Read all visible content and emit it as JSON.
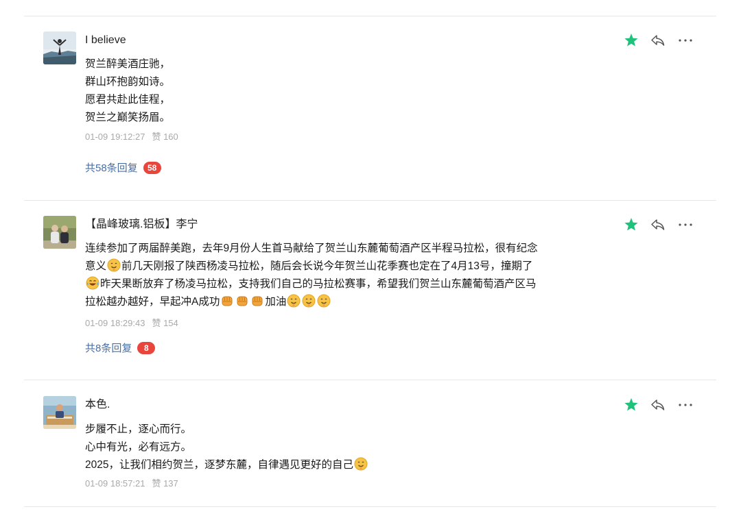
{
  "colors": {
    "star": "#1ec27a",
    "reply_link": "#4a6ea5",
    "badge": "#e8453c",
    "meta": "#a9a9a9"
  },
  "comments": [
    {
      "author": "I believe",
      "avatar": "avatar",
      "lines": [
        {
          "text": "贺兰醉美酒庄驰，"
        },
        {
          "text": "群山环抱韵如诗。"
        },
        {
          "text": "愿君共赴此佳程，"
        },
        {
          "text": "贺兰之巅笑扬眉。"
        }
      ],
      "time": "01-09 19:12:27",
      "likes": "赞 160",
      "replies_label": "共58条回复",
      "replies_count": "58",
      "icons": [
        "star-icon",
        "reply-arrow-icon",
        "more-dots-icon"
      ]
    },
    {
      "author": "【晶峰玻璃.铝板】李宁",
      "avatar": "avatar",
      "lines": [
        {
          "text": "连续参加了两届醉美跑，去年9月份人生首马献给了贺兰山东麓葡萄酒产区半程马拉松，很有纪念"
        },
        {
          "a": "意义",
          "b": "前几天刚报了陕西杨凌马拉松，随后会长说今年贺兰山花季赛也定在了4月13号，撞期了"
        },
        {
          "b": "昨天果断放弃了杨凌马拉松，支持我们自己的马拉松赛事，希望我们贺兰山东麓葡萄酒产区马"
        },
        {
          "a": "拉松越办越好，早起冲A成功",
          "c": "加油"
        }
      ],
      "time": "01-09 18:29:43",
      "likes": "赞 154",
      "replies_label": "共8条回复",
      "replies_count": "8",
      "icons": [
        "star-icon",
        "reply-arrow-icon",
        "more-dots-icon"
      ]
    },
    {
      "author": "本色.",
      "avatar": "avatar",
      "lines": [
        {
          "text": "步履不止，逐心而行。"
        },
        {
          "text": "心中有光，必有远方。"
        },
        {
          "a": "2025，让我们相约贺兰，逐梦东麓，自律遇见更好的自己"
        }
      ],
      "time": "01-09 18:57:21",
      "likes": "赞 137",
      "icons": [
        "star-icon",
        "reply-arrow-icon",
        "more-dots-icon"
      ]
    }
  ]
}
